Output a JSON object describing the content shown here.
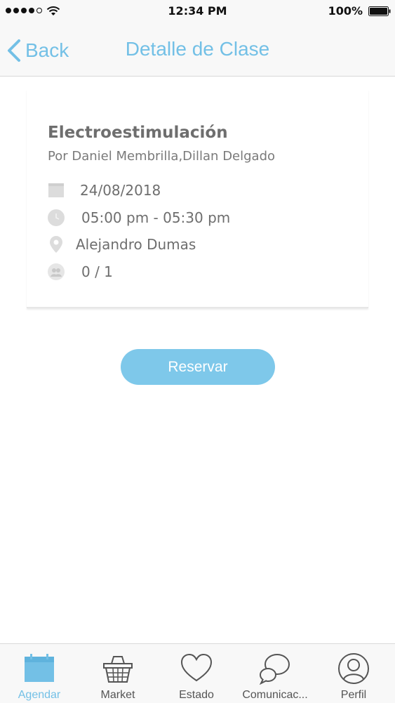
{
  "colors": {
    "accent": "#73c0e6",
    "button": "#7ec8ea",
    "text_dark": "#6e6e6e",
    "icon_gray": "#dcdcdc"
  },
  "status_bar": {
    "time": "12:34 PM",
    "battery": "100%"
  },
  "nav": {
    "back_label": "Back",
    "title": "Detalle de Clase"
  },
  "class_detail": {
    "title": "Electroestimulación",
    "instructors": "Por Daniel Membrilla,Dillan Delgado",
    "date": "24/08/2018",
    "time": "05:00 pm - 05:30 pm",
    "location": "Alejandro Dumas",
    "capacity": "0 / 1",
    "icons": [
      "calendar-icon",
      "clock-icon",
      "location-pin-icon",
      "users-icon"
    ]
  },
  "actions": {
    "reserve_label": "Reservar"
  },
  "tabs": [
    {
      "label": "Agendar",
      "icon": "calendar-icon",
      "active": true
    },
    {
      "label": "Market",
      "icon": "basket-icon",
      "active": false
    },
    {
      "label": "Estado",
      "icon": "heart-icon",
      "active": false
    },
    {
      "label": "Comunicac...",
      "icon": "chat-bubbles-icon",
      "active": false
    },
    {
      "label": "Perfil",
      "icon": "user-icon",
      "active": false
    }
  ]
}
